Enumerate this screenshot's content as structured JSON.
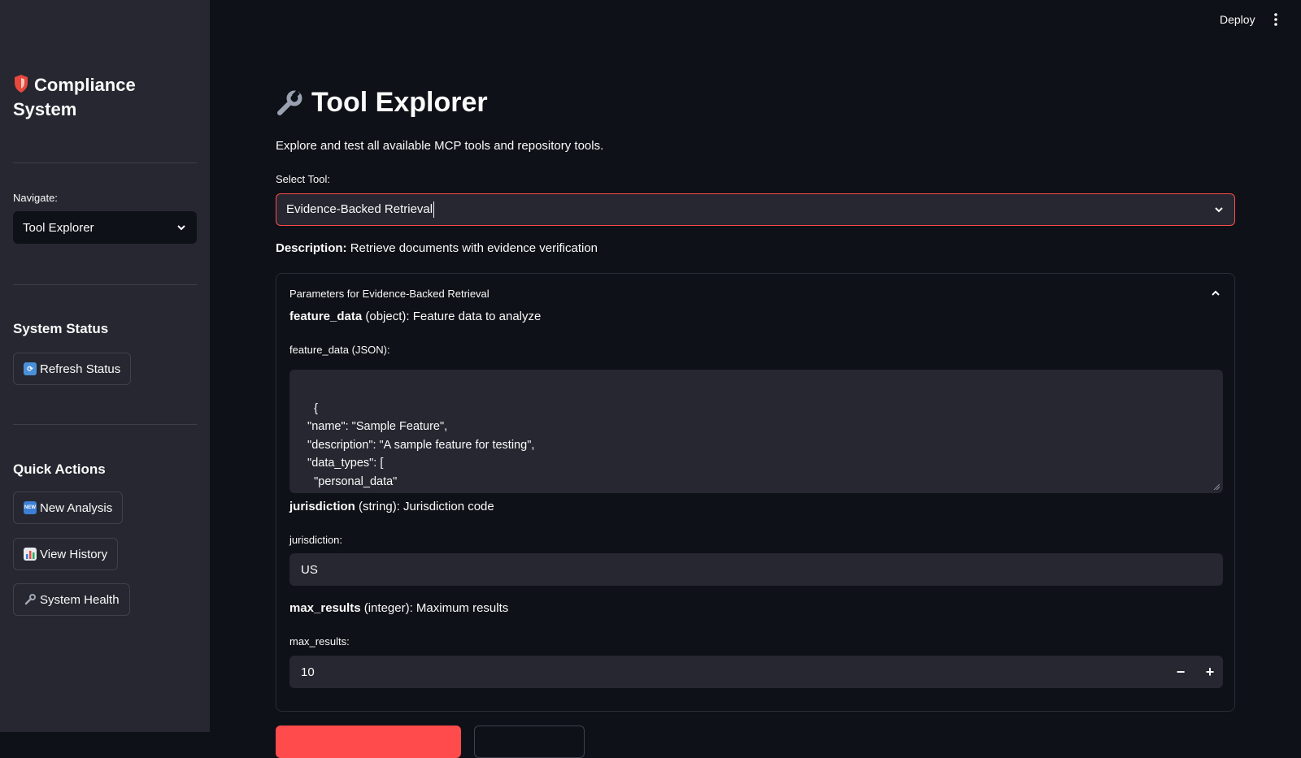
{
  "sidebar": {
    "title": "Compliance System",
    "title_icon": "shield-icon",
    "navigate_label": "Navigate:",
    "navigate_value": "Tool Explorer",
    "system_status_heading": "System Status",
    "refresh_label": "Refresh Status",
    "quick_actions_heading": "Quick Actions",
    "new_analysis_label": "New Analysis",
    "view_history_label": "View History",
    "system_health_label": "System Health"
  },
  "header": {
    "deploy_label": "Deploy"
  },
  "main": {
    "title": "Tool Explorer",
    "title_icon": "wrench-icon",
    "subtitle": "Explore and test all available MCP tools and repository tools.",
    "select_label": "Select Tool:",
    "select_value": "Evidence-Backed Retrieval",
    "description_label": "Description:",
    "description_text": "Retrieve documents with evidence verification",
    "expander_title": "Parameters for Evidence-Backed Retrieval",
    "params": {
      "feature_data": {
        "name": "feature_data",
        "meta": "(object): Feature data to analyze",
        "field_label": "feature_data (JSON):",
        "value": "{\n  \"name\": \"Sample Feature\",\n  \"description\": \"A sample feature for testing\",\n  \"data_types\": [\n    \"personal_data\"\n  ],"
      },
      "jurisdiction": {
        "name": "jurisdiction",
        "meta": "(string): Jurisdiction code",
        "field_label": "jurisdiction:",
        "value": "US"
      },
      "max_results": {
        "name": "max_results",
        "meta": "(integer): Maximum results",
        "field_label": "max_results:",
        "value": "10",
        "minus": "−",
        "plus": "+"
      }
    }
  },
  "colors": {
    "background": "#0e1117",
    "sidebar": "#262730",
    "accent": "#ff4b4b",
    "text": "#fafafa"
  }
}
